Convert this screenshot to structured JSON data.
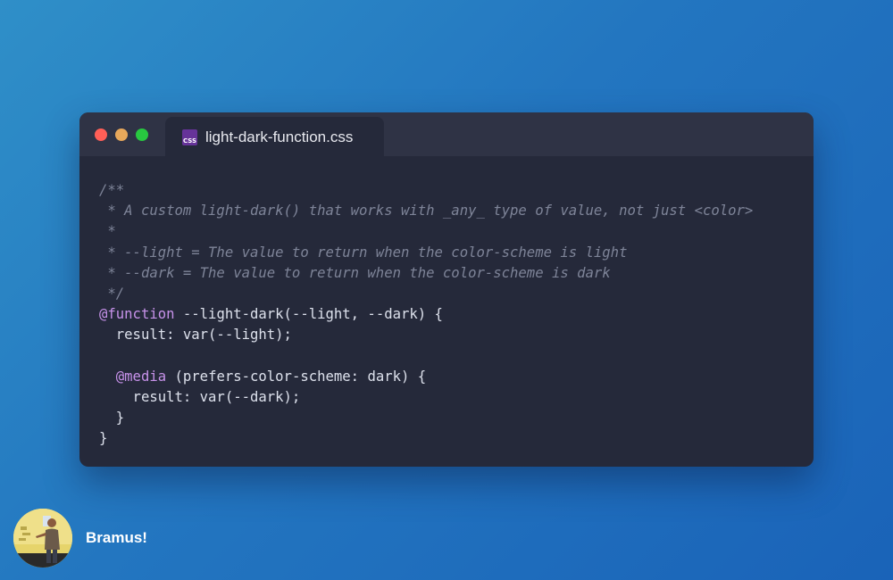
{
  "window": {
    "tab": {
      "icon": "css-file-icon",
      "icon_label": "CSS",
      "filename": "light-dark-function.css"
    },
    "code_lines": [
      {
        "text": "/**",
        "kind": "comment"
      },
      {
        "text": " * A custom light-dark() that works with _any_ type of value, not just <color>",
        "kind": "comment"
      },
      {
        "text": " *",
        "kind": "comment"
      },
      {
        "text": " * --light = The value to return when the color-scheme is light",
        "kind": "comment"
      },
      {
        "text": " * --dark = The value to return when the color-scheme is dark",
        "kind": "comment"
      },
      {
        "text": " */",
        "kind": "comment"
      },
      {
        "keyword": "@function",
        "rest": " --light-dark(--light, --dark) {",
        "kind": "keyword"
      },
      {
        "text": "  result: var(--light);",
        "kind": "plain"
      },
      {
        "text": "",
        "kind": "plain"
      },
      {
        "indent": "  ",
        "keyword": "@media",
        "rest": " (prefers-color-scheme: dark) {",
        "kind": "keyword"
      },
      {
        "text": "    result: var(--dark);",
        "kind": "plain"
      },
      {
        "text": "  }",
        "kind": "plain"
      },
      {
        "text": "}",
        "kind": "plain"
      }
    ]
  },
  "author": {
    "name": "Bramus!",
    "avatar_icon": "avatar-photo"
  },
  "colors": {
    "background_start": "#2f8fc8",
    "background_end": "#1a63b8",
    "editor_bg": "#25293a",
    "titlebar_bg": "#2f3345",
    "comment": "#7e8498",
    "keyword": "#c792ea",
    "code_text": "#dde1ec",
    "close": "#ff5f57",
    "minimize": "#e7a85b",
    "maximize": "#28c840"
  }
}
